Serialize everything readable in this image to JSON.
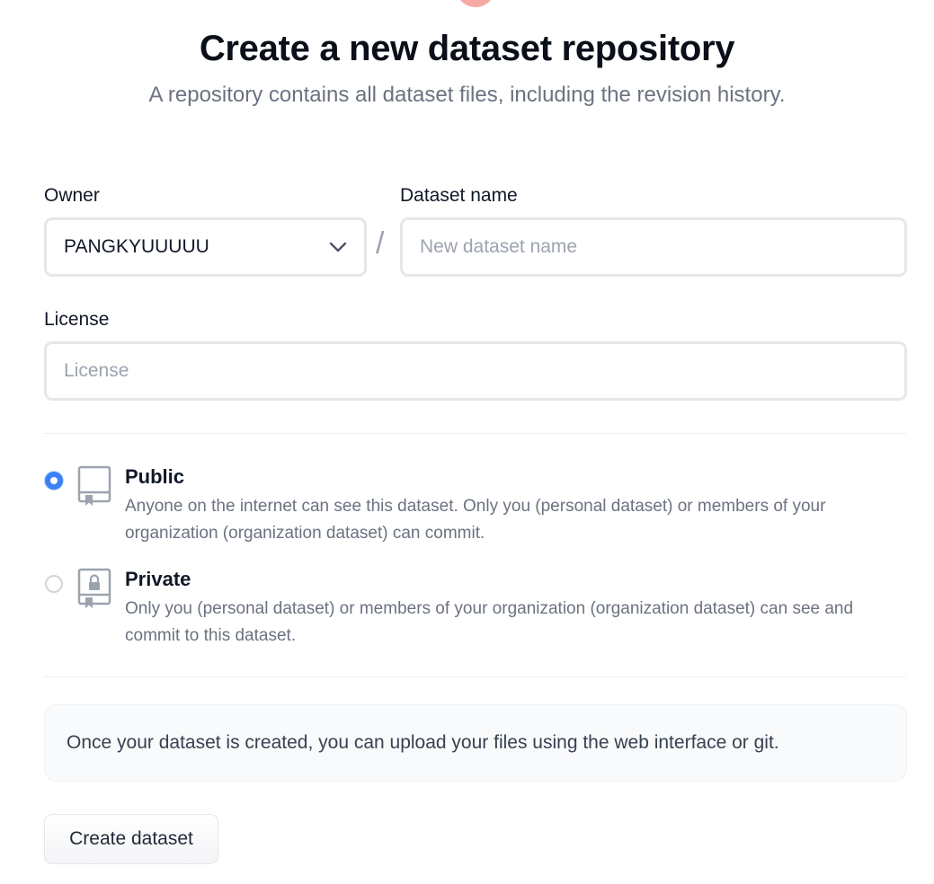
{
  "header": {
    "title": "Create a new dataset repository",
    "subtitle": "A repository contains all dataset files, including the revision history."
  },
  "form": {
    "owner_label": "Owner",
    "owner_value": "PANGKYUUUUU",
    "separator": "/",
    "dataset_name_label": "Dataset name",
    "dataset_name_placeholder": "New dataset name",
    "license_label": "License",
    "license_placeholder": "License"
  },
  "visibility": {
    "selected": "public",
    "options": [
      {
        "id": "public",
        "title": "Public",
        "description": "Anyone on the internet can see this dataset. Only you (personal dataset) or members of your organization (organization dataset) can commit.",
        "icon": "repo-book-icon"
      },
      {
        "id": "private",
        "title": "Private",
        "description": "Only you (personal dataset) or members of your organization (organization dataset) can see and commit to this dataset.",
        "icon": "repo-lock-icon"
      }
    ]
  },
  "info": {
    "text": "Once your dataset is created, you can upload your files using the web interface or git."
  },
  "actions": {
    "create_label": "Create dataset"
  },
  "colors": {
    "accent": "#3b82f6",
    "muted_text": "#6b7280",
    "border": "#e5e7eb",
    "logo_pink": "#f7a9a3"
  }
}
